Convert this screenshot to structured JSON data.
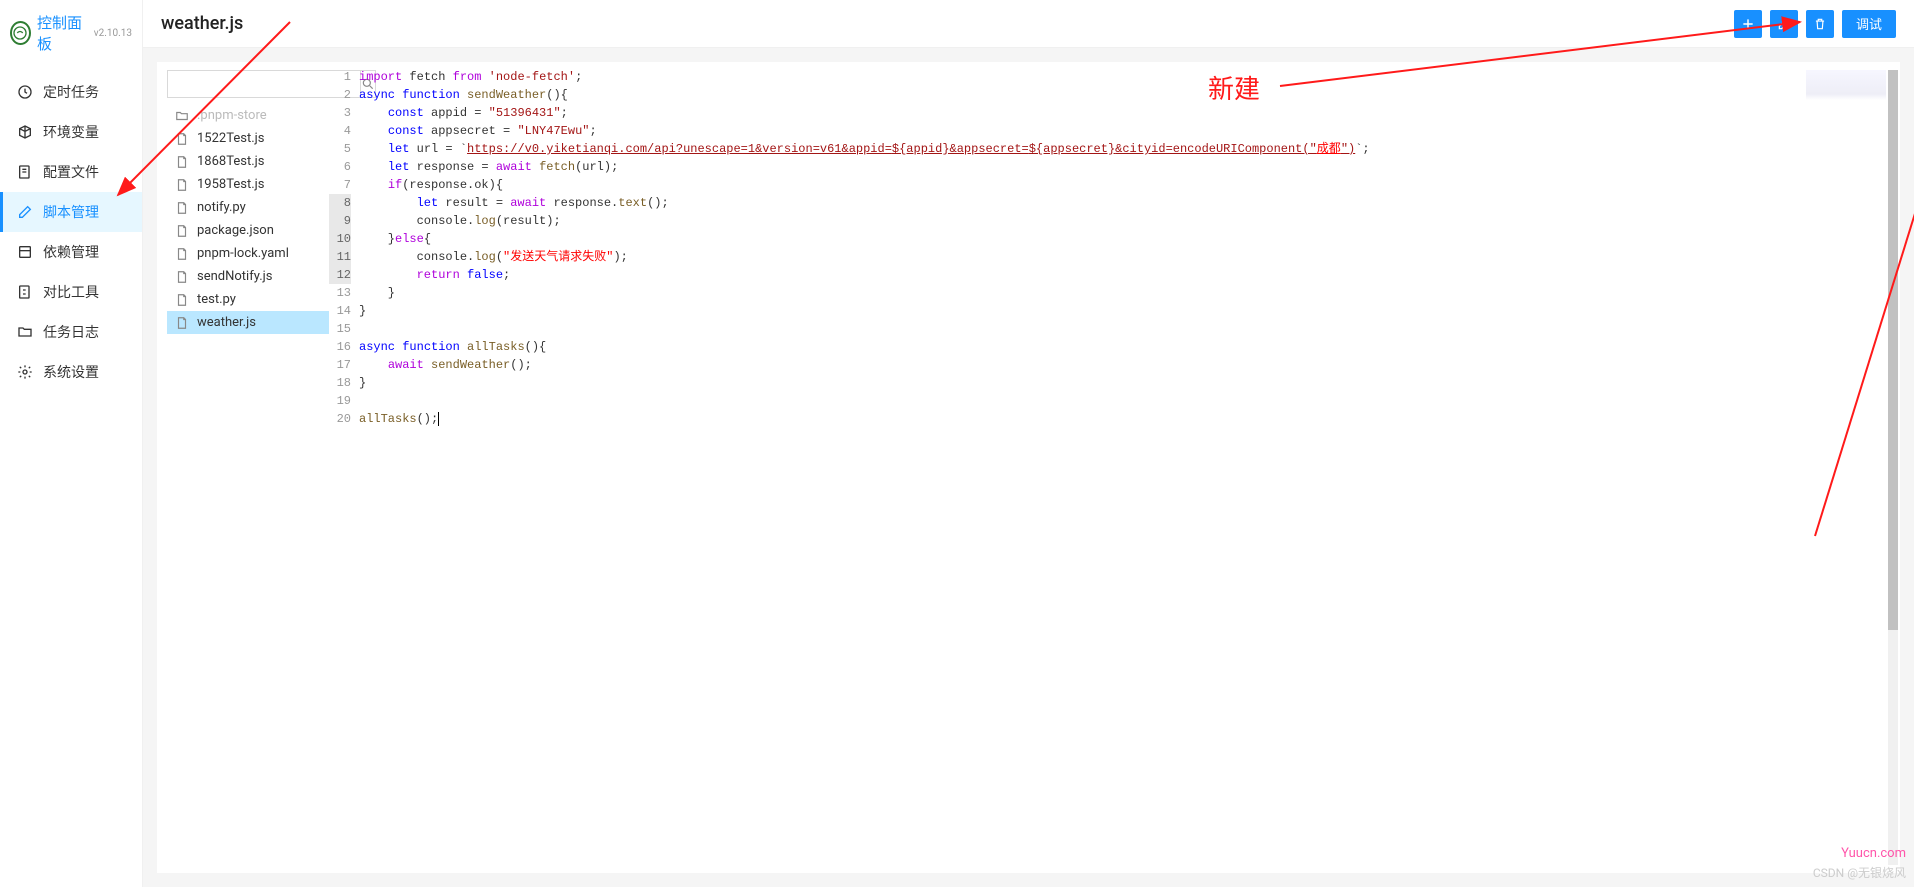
{
  "brand": {
    "title": "控制面板",
    "version": "v2.10.13"
  },
  "nav": {
    "items": [
      {
        "key": "cron",
        "label": "定时任务"
      },
      {
        "key": "env",
        "label": "环境变量"
      },
      {
        "key": "config",
        "label": "配置文件"
      },
      {
        "key": "script",
        "label": "脚本管理"
      },
      {
        "key": "deps",
        "label": "依赖管理"
      },
      {
        "key": "diff",
        "label": "对比工具"
      },
      {
        "key": "log",
        "label": "任务日志"
      },
      {
        "key": "settings",
        "label": "系统设置"
      }
    ],
    "active": "script"
  },
  "page": {
    "title": "weather.js"
  },
  "actions": {
    "debug_label": "调试"
  },
  "search": {
    "placeholder": ""
  },
  "files": [
    {
      "name": ".pnpm-store",
      "type": "folder",
      "muted": true
    },
    {
      "name": "1522Test.js",
      "type": "file"
    },
    {
      "name": "1868Test.js",
      "type": "file"
    },
    {
      "name": "1958Test.js",
      "type": "file"
    },
    {
      "name": "notify.py",
      "type": "file"
    },
    {
      "name": "package.json",
      "type": "file"
    },
    {
      "name": "pnpm-lock.yaml",
      "type": "file"
    },
    {
      "name": "sendNotify.js",
      "type": "file"
    },
    {
      "name": "test.py",
      "type": "file"
    },
    {
      "name": "weather.js",
      "type": "file",
      "selected": true
    }
  ],
  "code": {
    "appid": "51396431",
    "appsecret": "LNY47Ewu",
    "url_prefix": "https://v0.yiketianqi.com/api?unescape=1&version=v61&appid=",
    "url_mid1": "${appid}",
    "url_mid2": "&appsecret=",
    "url_mid3": "${appsecret}",
    "url_mid4": "&cityid=encodeURIComponent(\"",
    "url_cn": "成都",
    "url_end": "\")",
    "err_msg": "发送天气请求失败",
    "lines": 20
  },
  "annotation": {
    "text": "新建"
  },
  "watermarks": {
    "w1": "Yuucn.com",
    "w2": "CSDN @无银烧风"
  }
}
